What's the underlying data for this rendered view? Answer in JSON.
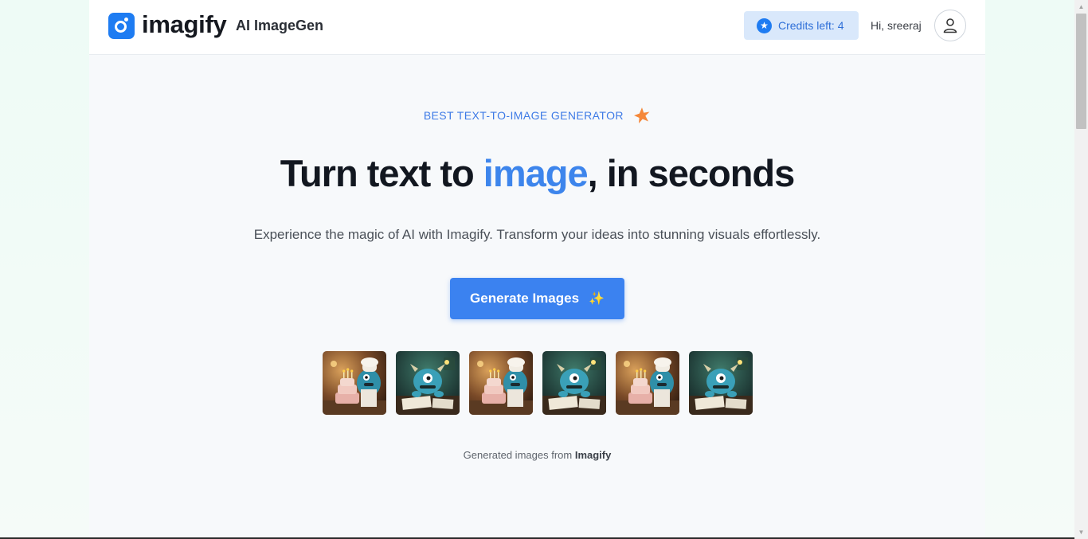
{
  "header": {
    "logo_text": "imagify",
    "logo_sub": "AI ImageGen",
    "credits_label": "Credits left: 4",
    "greeting": "Hi, sreeraj",
    "avatar_icon": "user-icon",
    "credits_icon": "star-icon"
  },
  "hero": {
    "badge": "BEST TEXT-TO-IMAGE GENERATOR",
    "badge_icon": "star-burst-icon",
    "headline_pre": "Turn text to ",
    "headline_accent": "image",
    "headline_post": ", in seconds",
    "subtext": "Experience the magic of AI with Imagify. Transform your ideas into stunning visuals effortlessly.",
    "cta_label": "Generate Images",
    "cta_icon": "sparkle-icon"
  },
  "gallery": {
    "images": [
      {
        "variant": "chef-cake"
      },
      {
        "variant": "monster-desk"
      },
      {
        "variant": "chef-cake"
      },
      {
        "variant": "monster-desk"
      },
      {
        "variant": "chef-cake"
      },
      {
        "variant": "monster-desk"
      }
    ],
    "caption_pre": "Generated images from ",
    "caption_brand": "Imagify"
  },
  "colors": {
    "accent": "#3b82f0",
    "brand": "#1e7cf2",
    "badge_text": "#3d7ae6",
    "credits_bg": "#d9e8fb"
  }
}
